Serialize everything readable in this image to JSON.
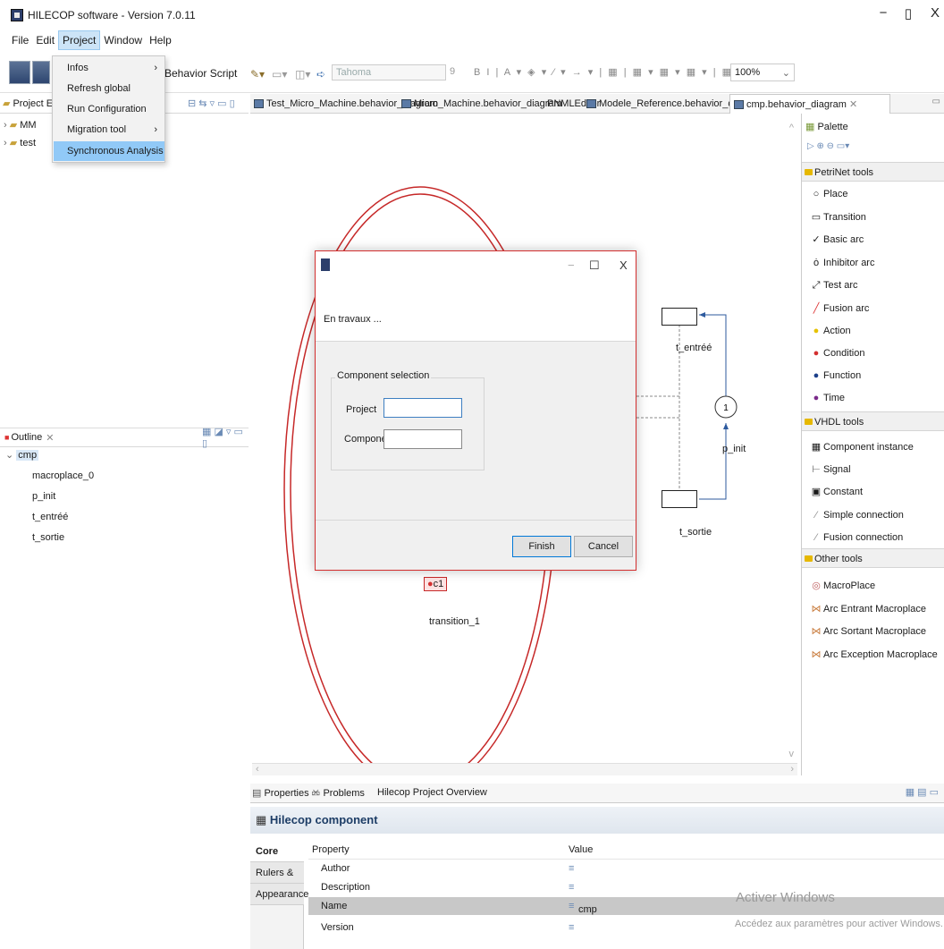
{
  "window": {
    "title": "HILECOP software - Version 7.0.11",
    "minimize_glyph": "−",
    "maximize_glyph": "▯",
    "close_glyph": "X"
  },
  "menubar": {
    "items": [
      "File",
      "Edit",
      "Project",
      "Window",
      "Help"
    ],
    "active": "Project"
  },
  "project_menu": {
    "items": [
      {
        "label": "Infos",
        "submenu": true
      },
      {
        "label": "Refresh global",
        "submenu": false
      },
      {
        "label": "Run Configuration",
        "submenu": false
      },
      {
        "label": "Migration tool",
        "submenu": true
      },
      {
        "label": "Synchronous Analysis",
        "submenu": false,
        "highlighted": true
      }
    ],
    "submenu_glyph": "›"
  },
  "toolbar": {
    "behavior_script": "Behavior Script",
    "font": "Tahoma",
    "font_size": "9",
    "zoom": "100%"
  },
  "project_explorer": {
    "tab_label": "Project E",
    "items": [
      "MM",
      "test"
    ]
  },
  "outline": {
    "tab_label": "Outline",
    "root": "cmp",
    "children": [
      "macroplace_0",
      "p_init",
      "t_entréé",
      "t_sortie"
    ]
  },
  "editor_tabs": [
    {
      "label": "Test_Micro_Machine.behavior_diagram",
      "active": false
    },
    {
      "label": "Micro_Machine.behavior_diagram",
      "active": false
    },
    {
      "label": "PNMLEditor",
      "active": false
    },
    {
      "label": "Modele_Reference.behavior_diagram",
      "active": false
    },
    {
      "label": "cmp.behavior_diagram",
      "active": true
    }
  ],
  "diagram": {
    "t_entree": "t_entréé",
    "t_sortie": "t_sortie",
    "p_init": "p_init",
    "p_init_tokens": "1",
    "condition": "c1",
    "transition": "transition_1"
  },
  "palette": {
    "title": "Palette",
    "sections": [
      {
        "title": "PetriNet tools",
        "items": [
          {
            "label": "Place",
            "icon": "place-icon"
          },
          {
            "label": "Transition",
            "icon": "transition-icon"
          },
          {
            "label": "Basic arc",
            "icon": "basic-arc-icon"
          },
          {
            "label": "Inhibitor arc",
            "icon": "inhibitor-arc-icon"
          },
          {
            "label": "Test arc",
            "icon": "test-arc-icon"
          },
          {
            "label": "Fusion arc",
            "icon": "fusion-arc-icon"
          },
          {
            "label": "Action",
            "icon": "action-icon"
          },
          {
            "label": "Condition",
            "icon": "condition-icon"
          },
          {
            "label": "Function",
            "icon": "function-icon"
          },
          {
            "label": "Time",
            "icon": "time-icon"
          }
        ]
      },
      {
        "title": "VHDL tools",
        "items": [
          {
            "label": "Component instance",
            "icon": "component-instance-icon"
          },
          {
            "label": "Signal",
            "icon": "signal-icon"
          },
          {
            "label": "Constant",
            "icon": "constant-icon"
          },
          {
            "label": "Simple connection",
            "icon": "simple-connection-icon"
          },
          {
            "label": "Fusion connection",
            "icon": "fusion-connection-icon"
          }
        ]
      },
      {
        "title": "Other tools",
        "items": [
          {
            "label": "MacroPlace",
            "icon": "macroplace-icon"
          },
          {
            "label": "Arc Entrant Macroplace",
            "icon": "arc-entrant-icon"
          },
          {
            "label": "Arc Sortant Macroplace",
            "icon": "arc-sortant-icon"
          },
          {
            "label": "Arc Exception Macroplace",
            "icon": "arc-exception-icon"
          }
        ]
      }
    ]
  },
  "properties": {
    "tabs": [
      "Properties",
      "Problems",
      "Hilecop Project Overview"
    ],
    "title": "Hilecop component",
    "side_tabs": [
      "Core",
      "Rulers & Grid",
      "Appearance"
    ],
    "header_property": "Property",
    "header_value": "Value",
    "rows": [
      {
        "property": "Author",
        "value": ""
      },
      {
        "property": "Description",
        "value": ""
      },
      {
        "property": "Name",
        "value": "cmp"
      },
      {
        "property": "Version",
        "value": ""
      }
    ]
  },
  "dialog": {
    "message": "En travaux ...",
    "group_title": "Component selection",
    "project_label": "Project",
    "project_value": "",
    "component_label": "Component",
    "component_value": "",
    "finish": "Finish",
    "cancel": "Cancel"
  },
  "watermark": {
    "line1": "Activer Windows",
    "line2": "Accédez aux paramètres pour activer Windows."
  },
  "colors": {
    "accent_red": "#d32f2f",
    "selection_blue": "#91c9f7",
    "menu_active": "#cce4f7",
    "header_blue": "#1d3d66"
  }
}
